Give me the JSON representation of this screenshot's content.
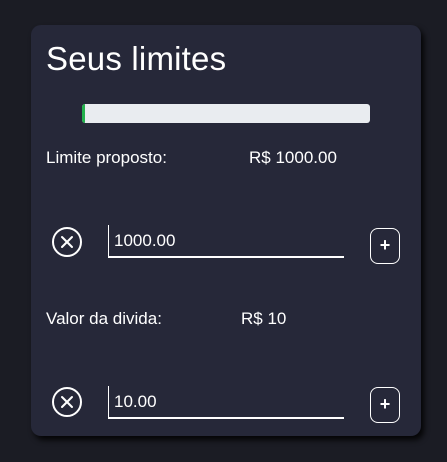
{
  "card": {
    "title": "Seus limites",
    "progress": {
      "fraction": 0.01,
      "color": "#22b14c"
    }
  },
  "limit_row": {
    "label": "Limite proposto:",
    "value": "R$ 1000.00",
    "input_value": "1000.00",
    "plus_label": "+",
    "clear_icon": "close-circle-icon"
  },
  "debt_row": {
    "label": "Valor da divida:",
    "value": "R$ 10",
    "input_value": "10.00",
    "plus_label": "+",
    "clear_icon": "close-circle-icon"
  }
}
